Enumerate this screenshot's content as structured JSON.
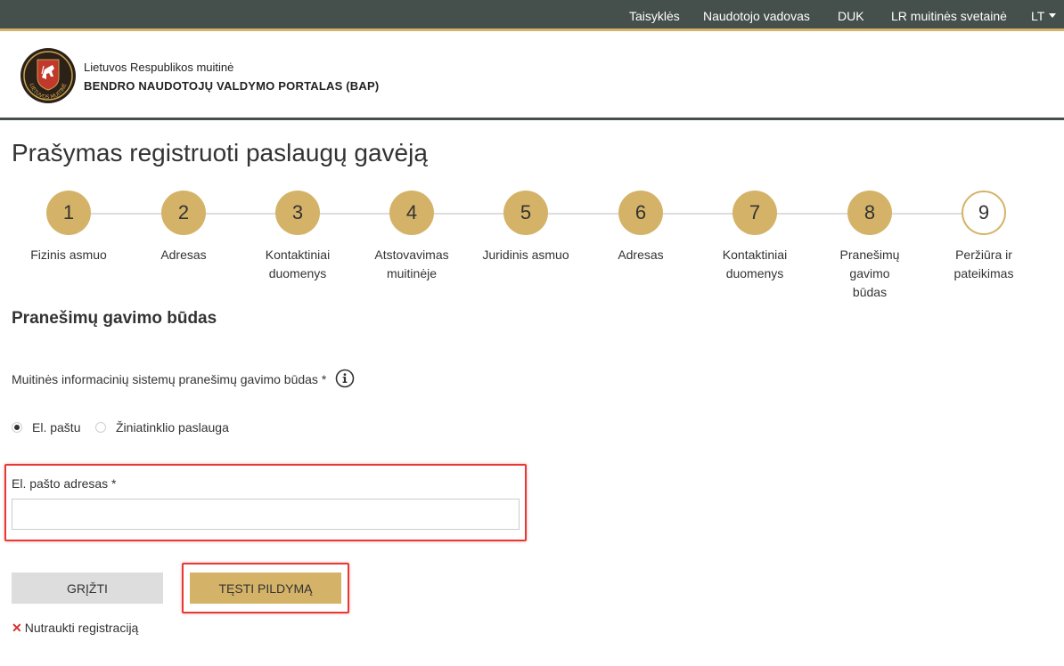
{
  "topnav": {
    "items": [
      "Taisyklės",
      "Naudotojo vadovas",
      "DUK",
      "LR muitinės svetainė"
    ],
    "language": "LT"
  },
  "header": {
    "logo_text": "LIETUVOS MUITINĖ",
    "org_name": "Lietuvos Respublikos muitinė",
    "portal_name": "BENDRO NAUDOTOJŲ VALDYMO PORTALAS (BAP)"
  },
  "page_title": "Prašymas registruoti paslaugų gavėją",
  "steps": [
    {
      "number": "1",
      "label": "Fizinis asmuo"
    },
    {
      "number": "2",
      "label": "Adresas"
    },
    {
      "number": "3",
      "label": "Kontaktiniai duomenys"
    },
    {
      "number": "4",
      "label": "Atstovavimas muitinėje"
    },
    {
      "number": "5",
      "label": "Juridinis asmuo"
    },
    {
      "number": "6",
      "label": "Adresas"
    },
    {
      "number": "7",
      "label": "Kontaktiniai duomenys"
    },
    {
      "number": "8",
      "label": "Pranešimų gavimo būdas"
    },
    {
      "number": "9",
      "label": "Peržiūra ir pateikimas"
    }
  ],
  "section_title": "Pranešimų gavimo būdas",
  "field_label": "Muitinės informacinių sistemų pranešimų gavimo būdas *",
  "radio_options": {
    "email": {
      "label": "El. paštu",
      "checked": true
    },
    "web": {
      "label": "Žiniatinklio paslauga",
      "checked": false
    }
  },
  "email_field": {
    "label": "El. pašto adresas *",
    "value": "",
    "placeholder": ""
  },
  "buttons": {
    "back": "GRĮŽTI",
    "next": "TĘSTI PILDYMĄ"
  },
  "cancel_link": "Nutraukti registraciją",
  "colors": {
    "topbar": "#454f4c",
    "accent_gold": "#d4b368",
    "highlight_red": "#e53935"
  }
}
